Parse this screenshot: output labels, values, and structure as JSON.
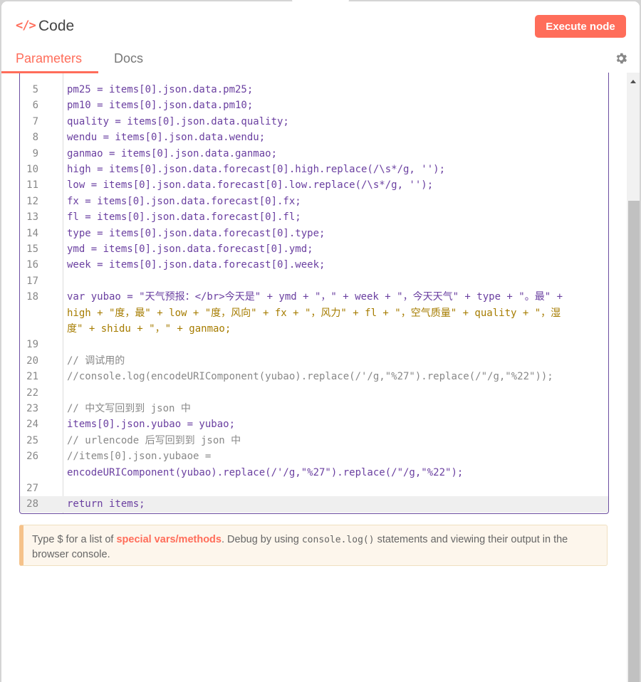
{
  "header": {
    "title": "Code",
    "execute_label": "Execute node",
    "tabs": [
      {
        "label": "Parameters",
        "active": true
      },
      {
        "label": "Docs",
        "active": false
      }
    ]
  },
  "editor": {
    "lines": [
      {
        "n": "5",
        "text": "pm25 = items[0].json.data.pm25;"
      },
      {
        "n": "6",
        "text": "pm10 = items[0].json.data.pm10;"
      },
      {
        "n": "7",
        "text": "quality = items[0].json.data.quality;"
      },
      {
        "n": "8",
        "text": "wendu = items[0].json.data.wendu;"
      },
      {
        "n": "9",
        "text": "ganmao = items[0].json.data.ganmao;"
      },
      {
        "n": "10",
        "text": "high = items[0].json.data.forecast[0].high.replace(/\\s*/g, '');"
      },
      {
        "n": "11",
        "text": "low = items[0].json.data.forecast[0].low.replace(/\\s*/g, '');"
      },
      {
        "n": "12",
        "text": "fx = items[0].json.data.forecast[0].fx;"
      },
      {
        "n": "13",
        "text": "fl = items[0].json.data.forecast[0].fl;"
      },
      {
        "n": "14",
        "text": "type = items[0].json.data.forecast[0].type;"
      },
      {
        "n": "15",
        "text": "ymd = items[0].json.data.forecast[0].ymd;"
      },
      {
        "n": "16",
        "text": "week = items[0].json.data.forecast[0].week;"
      },
      {
        "n": "17",
        "text": ""
      },
      {
        "n": "18",
        "text": "var yubao = \"天气预报：</br>今天是\" + ymd + \"，\" + week + \"，今天天气\" + type + \"。最\" +"
      },
      {
        "n": "",
        "text": "high + \"度，最\" + low + \"度，风向\" + fx + \"，风力\" + fl + \"，空气质量\" + quality + \"，湿"
      },
      {
        "n": "",
        "text": "度\" + shidu + \"，\" + ganmao;"
      },
      {
        "n": "19",
        "text": ""
      },
      {
        "n": "20",
        "text": "// 调试用的"
      },
      {
        "n": "21",
        "text": "//console.log(encodeURIComponent(yubao).replace(/'/g,\"%27\").replace(/\"/g,\"%22\"));"
      },
      {
        "n": "22",
        "text": ""
      },
      {
        "n": "23",
        "text": "// 中文写回到到 json 中"
      },
      {
        "n": "24",
        "text": "items[0].json.yubao = yubao;"
      },
      {
        "n": "25",
        "text": "// urlencode 后写回到到 json 中"
      },
      {
        "n": "26",
        "text": "//items[0].json.yubaoe ="
      },
      {
        "n": "",
        "text": "encodeURIComponent(yubao).replace(/'/g,\"%27\").replace(/\"/g,\"%22\");"
      },
      {
        "n": "27",
        "text": ""
      },
      {
        "n": "28",
        "text": "return items;"
      }
    ]
  },
  "hint": {
    "prefix": "Type $ for a list of ",
    "link": "special vars/methods",
    "middle": ". Debug by using ",
    "code": "console.log()",
    "suffix": " statements and viewing their output in the browser console."
  },
  "colors": {
    "accent": "#ff6d5a",
    "editor_border": "#6c4ea0",
    "keyword": "#6a3fa0",
    "string": "#a67c00",
    "comment": "#888888"
  }
}
